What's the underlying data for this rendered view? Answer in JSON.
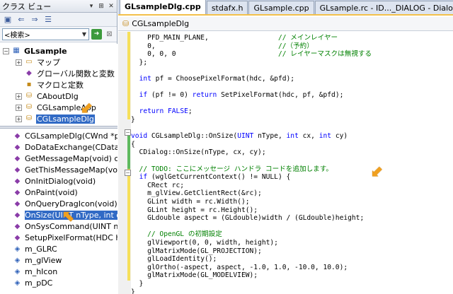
{
  "left_panel": {
    "title": "クラス ビュー",
    "title_buttons": [
      "▾",
      "⊞",
      "✕"
    ],
    "search_placeholder": "<検索>",
    "tree": [
      {
        "label": "GLsample",
        "icon": "▦",
        "expand": "⊟",
        "bold": true
      },
      {
        "label": "マップ",
        "icon": "▭",
        "expand": "⊞"
      },
      {
        "label": "グローバル関数と変数",
        "icon": "◆",
        "expand": ""
      },
      {
        "label": "マクロと定数",
        "icon": "▪",
        "expand": ""
      },
      {
        "label": "CAboutDlg",
        "icon": "⛁",
        "expand": "⊞"
      },
      {
        "label": "CGLsampleApp",
        "icon": "⛁",
        "expand": "⊞"
      },
      {
        "label": "CGLsampleDlg",
        "icon": "⛁",
        "expand": "⊞",
        "selected": true
      }
    ],
    "members": [
      {
        "label": "CGLsampleDlg(CWnd *pPar",
        "icon": "◆",
        "kind": "purple"
      },
      {
        "label": "DoDataExchange(CDataExcha",
        "icon": "◆",
        "kind": "purple"
      },
      {
        "label": "GetMessageMap(void) const",
        "icon": "◆",
        "kind": "purple"
      },
      {
        "label": "GetThisMessageMap(void)",
        "icon": "◆",
        "kind": "purple"
      },
      {
        "label": "OnInitDialog(void)",
        "icon": "◆",
        "kind": "purple"
      },
      {
        "label": "OnPaint(void)",
        "icon": "◆",
        "kind": "purple"
      },
      {
        "label": "OnQueryDragIcon(void)",
        "icon": "◆",
        "kind": "purple"
      },
      {
        "label": "OnSize(UINT nType, int cx,",
        "icon": "◆",
        "kind": "purple",
        "selected": true
      },
      {
        "label": "OnSysCommand(UINT nID, ",
        "icon": "◆",
        "kind": "purple"
      },
      {
        "label": "SetupPixelFormat(HDC hdc)",
        "icon": "◆",
        "kind": "purple"
      },
      {
        "label": "m_GLRC",
        "icon": "◈",
        "kind": "blue"
      },
      {
        "label": "m_glView",
        "icon": "◈",
        "kind": "blue"
      },
      {
        "label": "m_hIcon",
        "icon": "◈",
        "kind": "blue"
      },
      {
        "label": "m_pDC",
        "icon": "◈",
        "kind": "blue"
      }
    ]
  },
  "tabs": [
    "GLsampleDlg.cpp",
    "stdafx.h",
    "GLsample.cpp",
    "GLsample.rc - ID..._DIALOG - Dialog"
  ],
  "nav_class": "CGLsampleDlg",
  "code_lines": [
    {
      "t": "    PFD_MAIN_PLANE,                 // メインレイヤー",
      "s": "mix"
    },
    {
      "t": "    0,                              //（予約）",
      "s": "mix"
    },
    {
      "t": "    0, 0, 0                         // レイヤーマスクは無視する",
      "s": "mix"
    },
    {
      "t": "  };",
      "s": ""
    },
    {
      "t": "",
      "s": ""
    },
    {
      "t": "  int pf = ChoosePixelFormat(hdc, &pfd);",
      "s": "int"
    },
    {
      "t": "",
      "s": ""
    },
    {
      "t": "  if (pf != 0) return SetPixelFormat(hdc, pf, &pfd);",
      "s": "if"
    },
    {
      "t": "",
      "s": ""
    },
    {
      "t": "  return FALSE;",
      "s": "ret"
    },
    {
      "t": "}",
      "s": ""
    },
    {
      "t": "",
      "s": ""
    },
    {
      "t": "void CGLsampleDlg::OnSize(UINT nType, int cx, int cy)",
      "s": "void"
    },
    {
      "t": "{",
      "s": ""
    },
    {
      "t": "  CDialog::OnSize(nType, cx, cy);",
      "s": ""
    },
    {
      "t": "",
      "s": ""
    },
    {
      "t": "  // TODO: ここにメッセージ ハンドラ コードを追加します。",
      "s": "cm"
    },
    {
      "t": "  if (wglGetCurrentContext() != NULL) {",
      "s": "if"
    },
    {
      "t": "    CRect rc;",
      "s": ""
    },
    {
      "t": "    m_glView.GetClientRect(&rc);",
      "s": ""
    },
    {
      "t": "    GLint width = rc.Width();",
      "s": ""
    },
    {
      "t": "    GLint height = rc.Height();",
      "s": ""
    },
    {
      "t": "    GLdouble aspect = (GLdouble)width / (GLdouble)height;",
      "s": ""
    },
    {
      "t": "",
      "s": ""
    },
    {
      "t": "    // OpenGL の初期設定",
      "s": "cm"
    },
    {
      "t": "    glViewport(0, 0, width, height);",
      "s": ""
    },
    {
      "t": "    glMatrixMode(GL_PROJECTION);",
      "s": ""
    },
    {
      "t": "    glLoadIdentity();",
      "s": ""
    },
    {
      "t": "    glOrtho(-aspect, aspect, -1.0, 1.0, -10.0, 10.0);",
      "s": ""
    },
    {
      "t": "    glMatrixMode(GL_MODELVIEW);",
      "s": ""
    },
    {
      "t": "  }",
      "s": ""
    },
    {
      "t": "}",
      "s": ""
    }
  ]
}
